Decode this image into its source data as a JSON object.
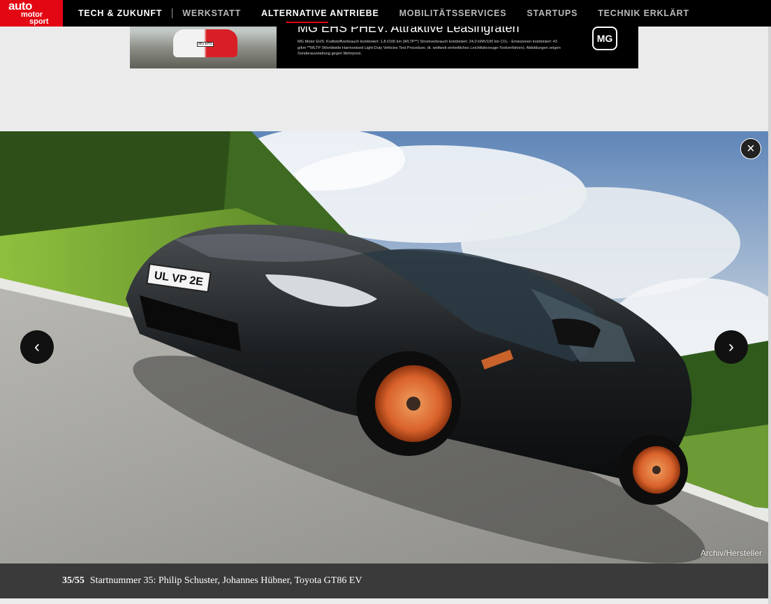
{
  "brand": {
    "line1": "auto",
    "line2": "motor",
    "line3": "sport",
    "color": "#e30613"
  },
  "nav": {
    "items": [
      {
        "label": "Tech & Zukunft"
      },
      {
        "label": "Werkstatt"
      },
      {
        "label": "Alternative Antriebe"
      },
      {
        "label": "Mobilitätsservices"
      },
      {
        "label": "Startups"
      },
      {
        "label": "Technik erklärt"
      }
    ]
  },
  "ad": {
    "title": "MG EHS PHEV: Attraktive Leasingraten",
    "plate": "MG EHS",
    "text": "MG Motor EHS: Kraftstoffverbrauch kombiniert: 1,8 l/100 km (WLTP**) Stromverbrauch kombiniert: 24,0 kWh/100 km CO₂ - Emissionen kombiniert: 43 g/km **WLTP (Worldwide Harmonised Light-Duty Vehicles Test Procedure, dt. weltweit einheitliches Leichtfahrzeuge-Testverfahren). Abbildungen zeigen Sonderausstattung gegen Mehrpreis.",
    "logo": "MG"
  },
  "gallery": {
    "close_icon": "×",
    "prev_icon": "‹",
    "next_icon": "›",
    "plate": "UL VP 2E",
    "credit": "Archiv/Hersteller"
  },
  "caption": {
    "counter": "35/55",
    "text": "Startnummer 35: Philip Schuster, Johannes Hübner, Toyota GT86 EV"
  }
}
